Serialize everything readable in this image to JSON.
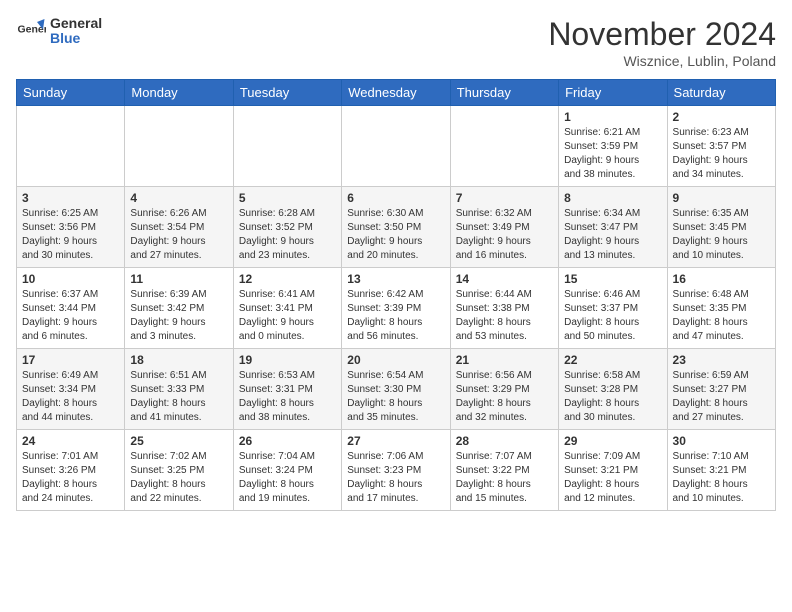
{
  "header": {
    "logo_general": "General",
    "logo_blue": "Blue",
    "month": "November 2024",
    "location": "Wisznice, Lublin, Poland"
  },
  "days_of_week": [
    "Sunday",
    "Monday",
    "Tuesday",
    "Wednesday",
    "Thursday",
    "Friday",
    "Saturday"
  ],
  "weeks": [
    [
      {
        "day": "",
        "info": ""
      },
      {
        "day": "",
        "info": ""
      },
      {
        "day": "",
        "info": ""
      },
      {
        "day": "",
        "info": ""
      },
      {
        "day": "",
        "info": ""
      },
      {
        "day": "1",
        "info": "Sunrise: 6:21 AM\nSunset: 3:59 PM\nDaylight: 9 hours\nand 38 minutes."
      },
      {
        "day": "2",
        "info": "Sunrise: 6:23 AM\nSunset: 3:57 PM\nDaylight: 9 hours\nand 34 minutes."
      }
    ],
    [
      {
        "day": "3",
        "info": "Sunrise: 6:25 AM\nSunset: 3:56 PM\nDaylight: 9 hours\nand 30 minutes."
      },
      {
        "day": "4",
        "info": "Sunrise: 6:26 AM\nSunset: 3:54 PM\nDaylight: 9 hours\nand 27 minutes."
      },
      {
        "day": "5",
        "info": "Sunrise: 6:28 AM\nSunset: 3:52 PM\nDaylight: 9 hours\nand 23 minutes."
      },
      {
        "day": "6",
        "info": "Sunrise: 6:30 AM\nSunset: 3:50 PM\nDaylight: 9 hours\nand 20 minutes."
      },
      {
        "day": "7",
        "info": "Sunrise: 6:32 AM\nSunset: 3:49 PM\nDaylight: 9 hours\nand 16 minutes."
      },
      {
        "day": "8",
        "info": "Sunrise: 6:34 AM\nSunset: 3:47 PM\nDaylight: 9 hours\nand 13 minutes."
      },
      {
        "day": "9",
        "info": "Sunrise: 6:35 AM\nSunset: 3:45 PM\nDaylight: 9 hours\nand 10 minutes."
      }
    ],
    [
      {
        "day": "10",
        "info": "Sunrise: 6:37 AM\nSunset: 3:44 PM\nDaylight: 9 hours\nand 6 minutes."
      },
      {
        "day": "11",
        "info": "Sunrise: 6:39 AM\nSunset: 3:42 PM\nDaylight: 9 hours\nand 3 minutes."
      },
      {
        "day": "12",
        "info": "Sunrise: 6:41 AM\nSunset: 3:41 PM\nDaylight: 9 hours\nand 0 minutes."
      },
      {
        "day": "13",
        "info": "Sunrise: 6:42 AM\nSunset: 3:39 PM\nDaylight: 8 hours\nand 56 minutes."
      },
      {
        "day": "14",
        "info": "Sunrise: 6:44 AM\nSunset: 3:38 PM\nDaylight: 8 hours\nand 53 minutes."
      },
      {
        "day": "15",
        "info": "Sunrise: 6:46 AM\nSunset: 3:37 PM\nDaylight: 8 hours\nand 50 minutes."
      },
      {
        "day": "16",
        "info": "Sunrise: 6:48 AM\nSunset: 3:35 PM\nDaylight: 8 hours\nand 47 minutes."
      }
    ],
    [
      {
        "day": "17",
        "info": "Sunrise: 6:49 AM\nSunset: 3:34 PM\nDaylight: 8 hours\nand 44 minutes."
      },
      {
        "day": "18",
        "info": "Sunrise: 6:51 AM\nSunset: 3:33 PM\nDaylight: 8 hours\nand 41 minutes."
      },
      {
        "day": "19",
        "info": "Sunrise: 6:53 AM\nSunset: 3:31 PM\nDaylight: 8 hours\nand 38 minutes."
      },
      {
        "day": "20",
        "info": "Sunrise: 6:54 AM\nSunset: 3:30 PM\nDaylight: 8 hours\nand 35 minutes."
      },
      {
        "day": "21",
        "info": "Sunrise: 6:56 AM\nSunset: 3:29 PM\nDaylight: 8 hours\nand 32 minutes."
      },
      {
        "day": "22",
        "info": "Sunrise: 6:58 AM\nSunset: 3:28 PM\nDaylight: 8 hours\nand 30 minutes."
      },
      {
        "day": "23",
        "info": "Sunrise: 6:59 AM\nSunset: 3:27 PM\nDaylight: 8 hours\nand 27 minutes."
      }
    ],
    [
      {
        "day": "24",
        "info": "Sunrise: 7:01 AM\nSunset: 3:26 PM\nDaylight: 8 hours\nand 24 minutes."
      },
      {
        "day": "25",
        "info": "Sunrise: 7:02 AM\nSunset: 3:25 PM\nDaylight: 8 hours\nand 22 minutes."
      },
      {
        "day": "26",
        "info": "Sunrise: 7:04 AM\nSunset: 3:24 PM\nDaylight: 8 hours\nand 19 minutes."
      },
      {
        "day": "27",
        "info": "Sunrise: 7:06 AM\nSunset: 3:23 PM\nDaylight: 8 hours\nand 17 minutes."
      },
      {
        "day": "28",
        "info": "Sunrise: 7:07 AM\nSunset: 3:22 PM\nDaylight: 8 hours\nand 15 minutes."
      },
      {
        "day": "29",
        "info": "Sunrise: 7:09 AM\nSunset: 3:21 PM\nDaylight: 8 hours\nand 12 minutes."
      },
      {
        "day": "30",
        "info": "Sunrise: 7:10 AM\nSunset: 3:21 PM\nDaylight: 8 hours\nand 10 minutes."
      }
    ]
  ]
}
